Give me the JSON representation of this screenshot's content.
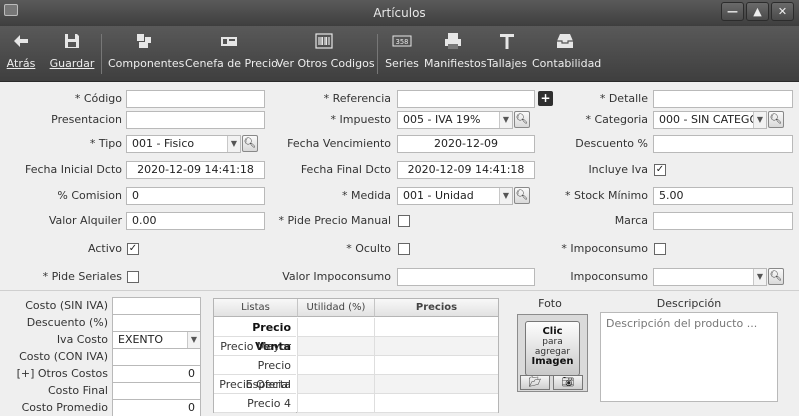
{
  "window": {
    "title": "Artículos"
  },
  "toolbar": [
    {
      "key": "atras",
      "label": "Atrás"
    },
    {
      "key": "guardar",
      "label": "Guardar"
    },
    {
      "key": "componentes",
      "label": "Componentes"
    },
    {
      "key": "cenefa",
      "label": "Cenefa de Precio"
    },
    {
      "key": "otros_codigos",
      "label": "Ver Otros Codigos"
    },
    {
      "key": "series",
      "label": "Series"
    },
    {
      "key": "manifiestos",
      "label": "Manifiestos"
    },
    {
      "key": "tallajes",
      "label": "Tallajes"
    },
    {
      "key": "contabilidad",
      "label": "Contabilidad"
    }
  ],
  "form": {
    "codigo": {
      "label": "* Código",
      "value": ""
    },
    "referencia": {
      "label": "* Referencia",
      "value": ""
    },
    "detalle": {
      "label": "* Detalle",
      "value": ""
    },
    "presentacion": {
      "label": "Presentacion",
      "value": ""
    },
    "impuesto": {
      "label": "* Impuesto",
      "value": "005 - IVA 19%"
    },
    "categoria": {
      "label": "* Categoria",
      "value": "000 - SIN CATEGO"
    },
    "tipo": {
      "label": "* Tipo",
      "value": "001 - Fisico"
    },
    "fecha_vencimiento": {
      "label": "Fecha Vencimiento",
      "value": "2020-12-09"
    },
    "descuento": {
      "label": "Descuento %",
      "value": ""
    },
    "fecha_inicial": {
      "label": "Fecha Inicial Dcto",
      "value": "2020-12-09 14:41:18"
    },
    "fecha_final": {
      "label": "Fecha Final Dcto",
      "value": "2020-12-09 14:41:18"
    },
    "incluye_iva": {
      "label": "Incluye Iva",
      "checked": true
    },
    "comision": {
      "label": "% Comision",
      "value": "0"
    },
    "medida": {
      "label": "* Medida",
      "value": "001 - Unidad"
    },
    "stock_minimo": {
      "label": "* Stock Mínimo",
      "value": "5.00"
    },
    "valor_alquiler": {
      "label": "Valor Alquiler",
      "value": "0.00"
    },
    "pide_precio": {
      "label": "* Pide Precio Manual",
      "checked": false
    },
    "marca": {
      "label": "Marca",
      "value": ""
    },
    "activo": {
      "label": "Activo",
      "checked": true
    },
    "oculto": {
      "label": "* Oculto",
      "checked": false
    },
    "impoconsumo_chk": {
      "label": "* Impoconsumo",
      "checked": false
    },
    "pide_seriales": {
      "label": "* Pide Seriales",
      "checked": false
    },
    "valor_impoconsumo": {
      "label": "Valor Impoconsumo",
      "value": ""
    },
    "impoconsumo_sel": {
      "label": "Impoconsumo",
      "value": ""
    }
  },
  "costos": {
    "costo_sin_iva": {
      "label": "Costo (SIN IVA)",
      "value": ""
    },
    "descuento": {
      "label": "Descuento (%)",
      "value": ""
    },
    "iva_costo": {
      "label": "Iva Costo",
      "value": "EXENTO"
    },
    "costo_con_iva": {
      "label": "Costo (CON IVA)",
      "value": ""
    },
    "otros_costos": {
      "label": "[+] Otros Costos",
      "value": "0"
    },
    "costo_final": {
      "label": "Costo Final",
      "value": ""
    },
    "costo_promedio": {
      "label": "Costo Promedio",
      "value": "0"
    }
  },
  "precios": {
    "headers": [
      "Listas",
      "Utilidad (%)",
      "Precios"
    ],
    "rows": [
      "Precio Venta",
      "Precio Mayor",
      "Precio Especial",
      "Precio Oferta",
      "Precio 4"
    ]
  },
  "foto": {
    "label": "Foto",
    "button_line1": "Clic",
    "button_line2": "para",
    "button_line3": "agregar",
    "button_line4": "Imagen"
  },
  "descripcion": {
    "label": "Descripción",
    "placeholder": "Descripción del producto ..."
  }
}
